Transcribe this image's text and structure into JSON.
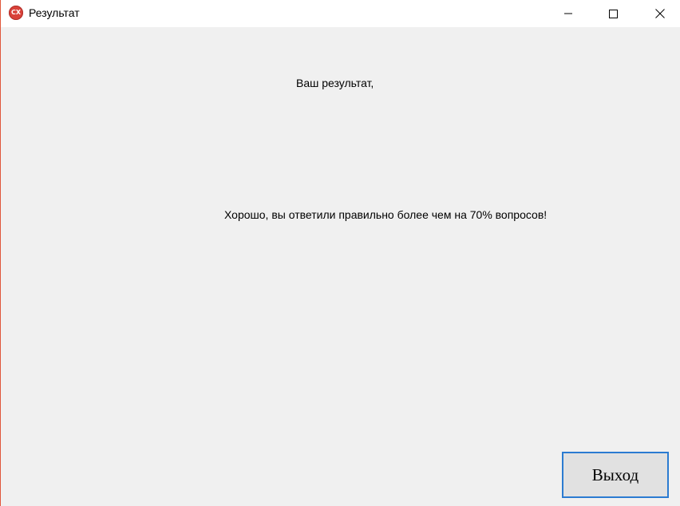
{
  "window": {
    "title": "Результат",
    "app_icon_text": "CX",
    "icon": "app-icon",
    "controls": [
      "minimize-icon",
      "maximize-icon",
      "close-icon"
    ]
  },
  "content": {
    "heading": "Ваш результат,",
    "message": "Хорошо, вы ответили правильно более чем на 70% вопросов!",
    "exit_label": "Выход"
  },
  "colors": {
    "accent_border": "#2b7bd1",
    "window_edge": "#e0573b",
    "background": "#f0f0f0",
    "titlebar": "#ffffff"
  }
}
